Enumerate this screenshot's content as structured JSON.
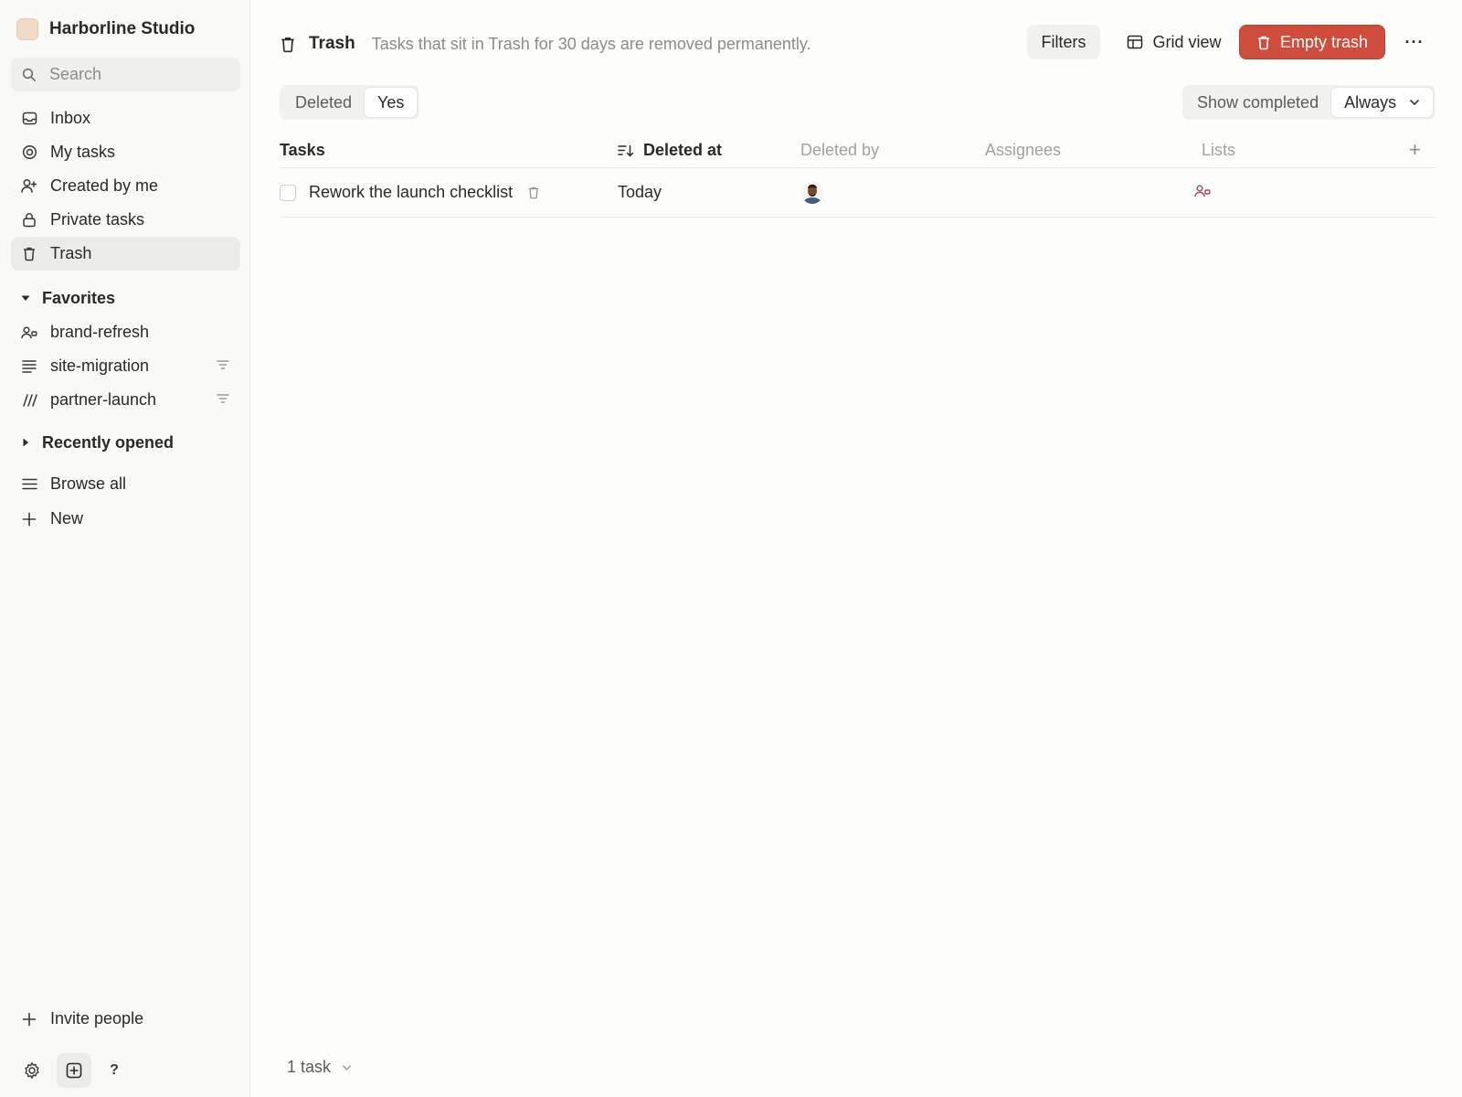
{
  "workspace": {
    "name": "Harborline Studio"
  },
  "search": {
    "placeholder": "Search"
  },
  "nav": {
    "inbox": "Inbox",
    "my_tasks": "My tasks",
    "created_by_me": "Created by me",
    "private_tasks": "Private tasks",
    "trash": "Trash"
  },
  "favorites": {
    "label": "Favorites",
    "items": [
      {
        "label": "brand-refresh",
        "icon": "team-list-icon"
      },
      {
        "label": "site-migration",
        "icon": "lines-list-icon",
        "filter": true
      },
      {
        "label": "partner-launch",
        "icon": "slashes-list-icon",
        "filter": true
      }
    ]
  },
  "recently_opened": {
    "label": "Recently opened"
  },
  "browse_all": "Browse all",
  "new": "New",
  "invite": "Invite people",
  "help": "?",
  "page": {
    "title": "Trash",
    "description": "Tasks that sit in Trash for 30 days are removed permanently."
  },
  "toolbar": {
    "filters": "Filters",
    "grid_view": "Grid view",
    "empty_trash": "Empty trash",
    "more": "···"
  },
  "filter_chip": {
    "field": "Deleted",
    "value": "Yes"
  },
  "show_completed": {
    "label": "Show completed",
    "value": "Always"
  },
  "table": {
    "columns": {
      "tasks": "Tasks",
      "deleted_at": "Deleted at",
      "deleted_by": "Deleted by",
      "assignees": "Assignees",
      "lists": "Lists",
      "add": "+"
    },
    "rows": [
      {
        "title": "Rework the launch checklist",
        "deleted_at": "Today"
      }
    ]
  },
  "footer": {
    "count": "1 task"
  },
  "colors": {
    "accent_danger": "#cf4d3c",
    "list_icon": "#b04a5a"
  }
}
